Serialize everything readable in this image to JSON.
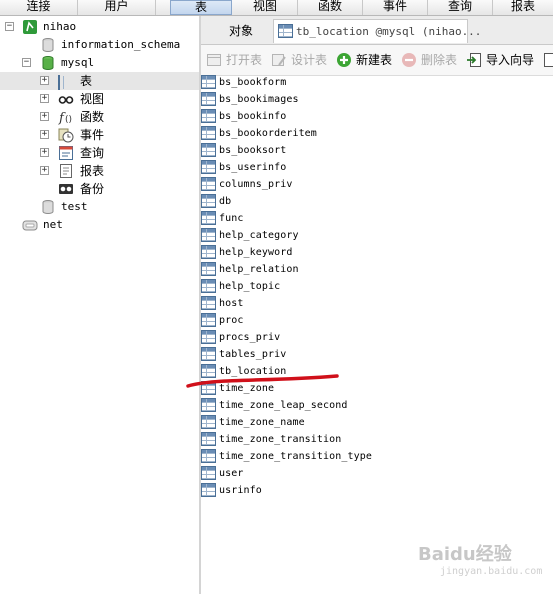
{
  "menu": [
    "连接",
    "用户",
    "表",
    "视图",
    "函数",
    "事件",
    "查询",
    "报表"
  ],
  "menu_active": "表",
  "tree": {
    "connection": "nihao",
    "databases": [
      {
        "name": "information_schema"
      },
      {
        "name": "mysql"
      },
      {
        "name": "test"
      }
    ],
    "mysql_children": [
      "表",
      "视图",
      "函数",
      "事件",
      "查询",
      "报表",
      "备份"
    ],
    "other_connection": "net",
    "expander_expanded": "−",
    "expander_collapsed": "+"
  },
  "tabs": {
    "objects": "对象",
    "active": "tb_location @mysql (nihao..."
  },
  "toolbar": {
    "open": "打开表",
    "design": "设计表",
    "new": "新建表",
    "delete": "删除表",
    "import": "导入向导"
  },
  "tables": [
    "bs_bookform",
    "bs_bookimages",
    "bs_bookinfo",
    "bs_bookorderitem",
    "bs_booksort",
    "bs_userinfo",
    "columns_priv",
    "db",
    "func",
    "help_category",
    "help_keyword",
    "help_relation",
    "help_topic",
    "host",
    "proc",
    "procs_priv",
    "tables_priv",
    "tb_location",
    "time_zone",
    "time_zone_leap_second",
    "time_zone_name",
    "time_zone_transition",
    "time_zone_transition_type",
    "user",
    "usrinfo"
  ],
  "highlighted_table": "tb_location",
  "annotation_color": "#d0101a",
  "watermark": "Baidu经验",
  "watermark_sub": "jingyan.baidu.com"
}
